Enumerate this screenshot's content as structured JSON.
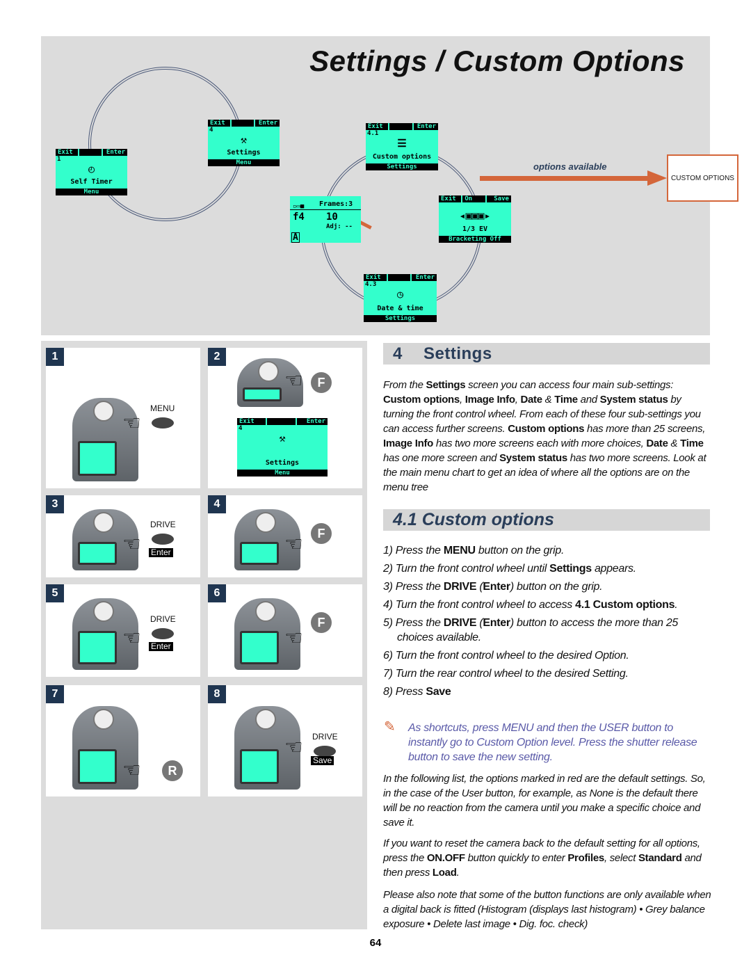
{
  "header": {
    "title": "Settings / Custom Options"
  },
  "diagram": {
    "options_label": "options available",
    "custom_options_box": "CUSTOM OPTIONS",
    "accent": "#d4663a",
    "lcd_color": "#33ffcc",
    "screens": [
      {
        "id": "self-timer",
        "top": [
          "Exit",
          "",
          "Enter"
        ],
        "num": "1",
        "icon": "timer-icon",
        "title": "Self Timer",
        "bottom": "Menu"
      },
      {
        "id": "settings",
        "top": [
          "Exit",
          "",
          "Enter"
        ],
        "num": "4",
        "icon": "wrench-icon",
        "title": "Settings",
        "bottom": "Menu"
      },
      {
        "id": "custom-options",
        "top": [
          "Exit",
          "",
          "Enter"
        ],
        "num": "4.1",
        "icon": "sliders-icon",
        "title": "Custom options",
        "bottom": "Settings"
      },
      {
        "id": "bracketing",
        "top": [
          "Exit",
          "On",
          "Save"
        ],
        "num": "",
        "icon": "bracketing-icons",
        "title": "1/3 EV",
        "bottom": "Bracketing Off"
      },
      {
        "id": "date-time",
        "top": [
          "Exit",
          "",
          "Enter"
        ],
        "num": "4.3",
        "icon": "clock-icon",
        "title": "Date & time",
        "bottom": "Settings"
      }
    ],
    "main_screen": {
      "frames": "Frames:3",
      "aperture": "f4",
      "shutter": "10",
      "adj": "Adj: --",
      "mode": "A"
    }
  },
  "steps_panel": {
    "cells": [
      {
        "n": "1",
        "label": "MENU"
      },
      {
        "n": "2",
        "knob": "F",
        "lcd": {
          "top": [
            "Exit",
            "",
            "Enter"
          ],
          "num": "4",
          "title": "Settings",
          "bottom": "Menu"
        }
      },
      {
        "n": "3",
        "label": "DRIVE",
        "tag": "Enter"
      },
      {
        "n": "4",
        "knob": "F"
      },
      {
        "n": "5",
        "label": "DRIVE",
        "tag": "Enter"
      },
      {
        "n": "6",
        "knob": "F"
      },
      {
        "n": "7",
        "knob": "R"
      },
      {
        "n": "8",
        "label": "DRIVE",
        "tag": "Save"
      }
    ]
  },
  "section4": {
    "number": "4",
    "title": "Settings",
    "para": [
      [
        "From the "
      ],
      [
        "Settings",
        1
      ],
      [
        " screen you can access four main sub-settings: "
      ],
      [
        "Custom options",
        1
      ],
      [
        ", "
      ],
      [
        "Image Info",
        1
      ],
      [
        ", "
      ],
      [
        "Date",
        1
      ],
      [
        " & "
      ],
      [
        "Time",
        1
      ],
      [
        " and "
      ],
      [
        "System status",
        1
      ],
      [
        " by turning the front control wheel. From each of these four sub-settings you can access further screens. "
      ],
      [
        "Custom options",
        1
      ],
      [
        " has more than 25 screens, "
      ],
      [
        "Image Info",
        1
      ],
      [
        " has two more screens each with more choices, "
      ],
      [
        "Date",
        1
      ],
      [
        " & "
      ],
      [
        "Time",
        1
      ],
      [
        " has one more screen and "
      ],
      [
        "System status",
        1
      ],
      [
        " has two more screens. Look at the main menu chart to get an idea of where all the options are on the menu tree"
      ]
    ]
  },
  "section41": {
    "title": "4.1 Custom options",
    "steps": [
      [
        [
          "1)  Press the "
        ],
        [
          "MENU",
          1
        ],
        [
          " button on the grip."
        ]
      ],
      [
        [
          "2)  Turn the front control wheel until "
        ],
        [
          "Settings",
          1
        ],
        [
          " appears."
        ]
      ],
      [
        [
          "3)  Press the "
        ],
        [
          "DRIVE",
          1
        ],
        [
          " ("
        ],
        [
          "Enter",
          1
        ],
        [
          ") button on the grip."
        ]
      ],
      [
        [
          "4)  Turn the front control wheel to access "
        ],
        [
          "4.1 Custom options",
          1
        ],
        [
          "."
        ]
      ],
      [
        [
          "5)  Press the "
        ],
        [
          "DRIVE",
          1
        ],
        [
          " ("
        ],
        [
          "Enter",
          1
        ],
        [
          ") button to access the more than 25 choices available."
        ]
      ],
      [
        [
          "6)  Turn the front control wheel to the desired Option."
        ]
      ],
      [
        [
          "7)  Turn the rear control wheel to the desired Setting."
        ]
      ],
      [
        [
          "8)  Press "
        ],
        [
          "Save",
          1
        ]
      ]
    ],
    "note": "As shortcuts, press MENU and then the USER button to instantly go to Custom Option level. Press the shutter release button to save the new setting.",
    "note_color": "#5a5aa8",
    "paras": [
      [
        [
          "In the following list, the options marked in red are the default settings. So, in the case of the User button, for example, as None is the default there will be no reaction from the camera until you make a specific choice and save it."
        ]
      ],
      [
        [
          "If you want to reset the camera back to the default setting for all options, press the "
        ],
        [
          "ON.OFF",
          1
        ],
        [
          " button quickly to enter "
        ],
        [
          "Profiles",
          1
        ],
        [
          ", select "
        ],
        [
          "Standard",
          1
        ],
        [
          " and then press "
        ],
        [
          "Load",
          1
        ],
        [
          "."
        ]
      ],
      [
        [
          "Please also note that some of the button functions are only available when a digital back is fitted (Histogram (displays last histogram) • Grey balance exposure • Delete last image • Dig. foc. check)"
        ]
      ]
    ]
  },
  "footer": {
    "page": "64"
  }
}
